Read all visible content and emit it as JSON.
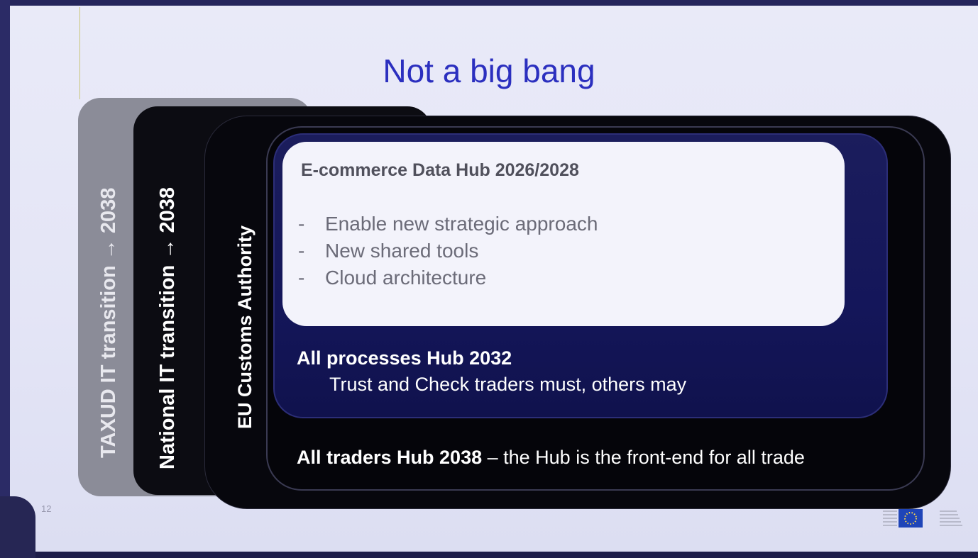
{
  "slide": {
    "title": "Not a big bang",
    "page_number": "12",
    "layers": {
      "taxud": "TAXUD IT transition → 2038",
      "national": "National IT transition → 2038",
      "eu_customs": "EU Customs Authority"
    },
    "ecommerce": {
      "title": "E-commerce Data Hub 2026/2028",
      "bullets": [
        "Enable new strategic approach",
        "New shared tools",
        "Cloud architecture"
      ],
      "dash": "-"
    },
    "all_processes": {
      "title": "All processes Hub 2032",
      "subtitle": "Trust and Check traders must, others may"
    },
    "all_traders": {
      "bold": "All traders Hub 2038",
      "rest": " – the Hub is the front-end for all trade"
    }
  },
  "colors": {
    "title": "#2b2fbf",
    "frame": "#2a2a66",
    "eu_flag_blue": "#1f45b8",
    "eu_stars": "#ffd94a"
  },
  "icons": [
    "eu-flag-icon",
    "european-commission-logo"
  ]
}
